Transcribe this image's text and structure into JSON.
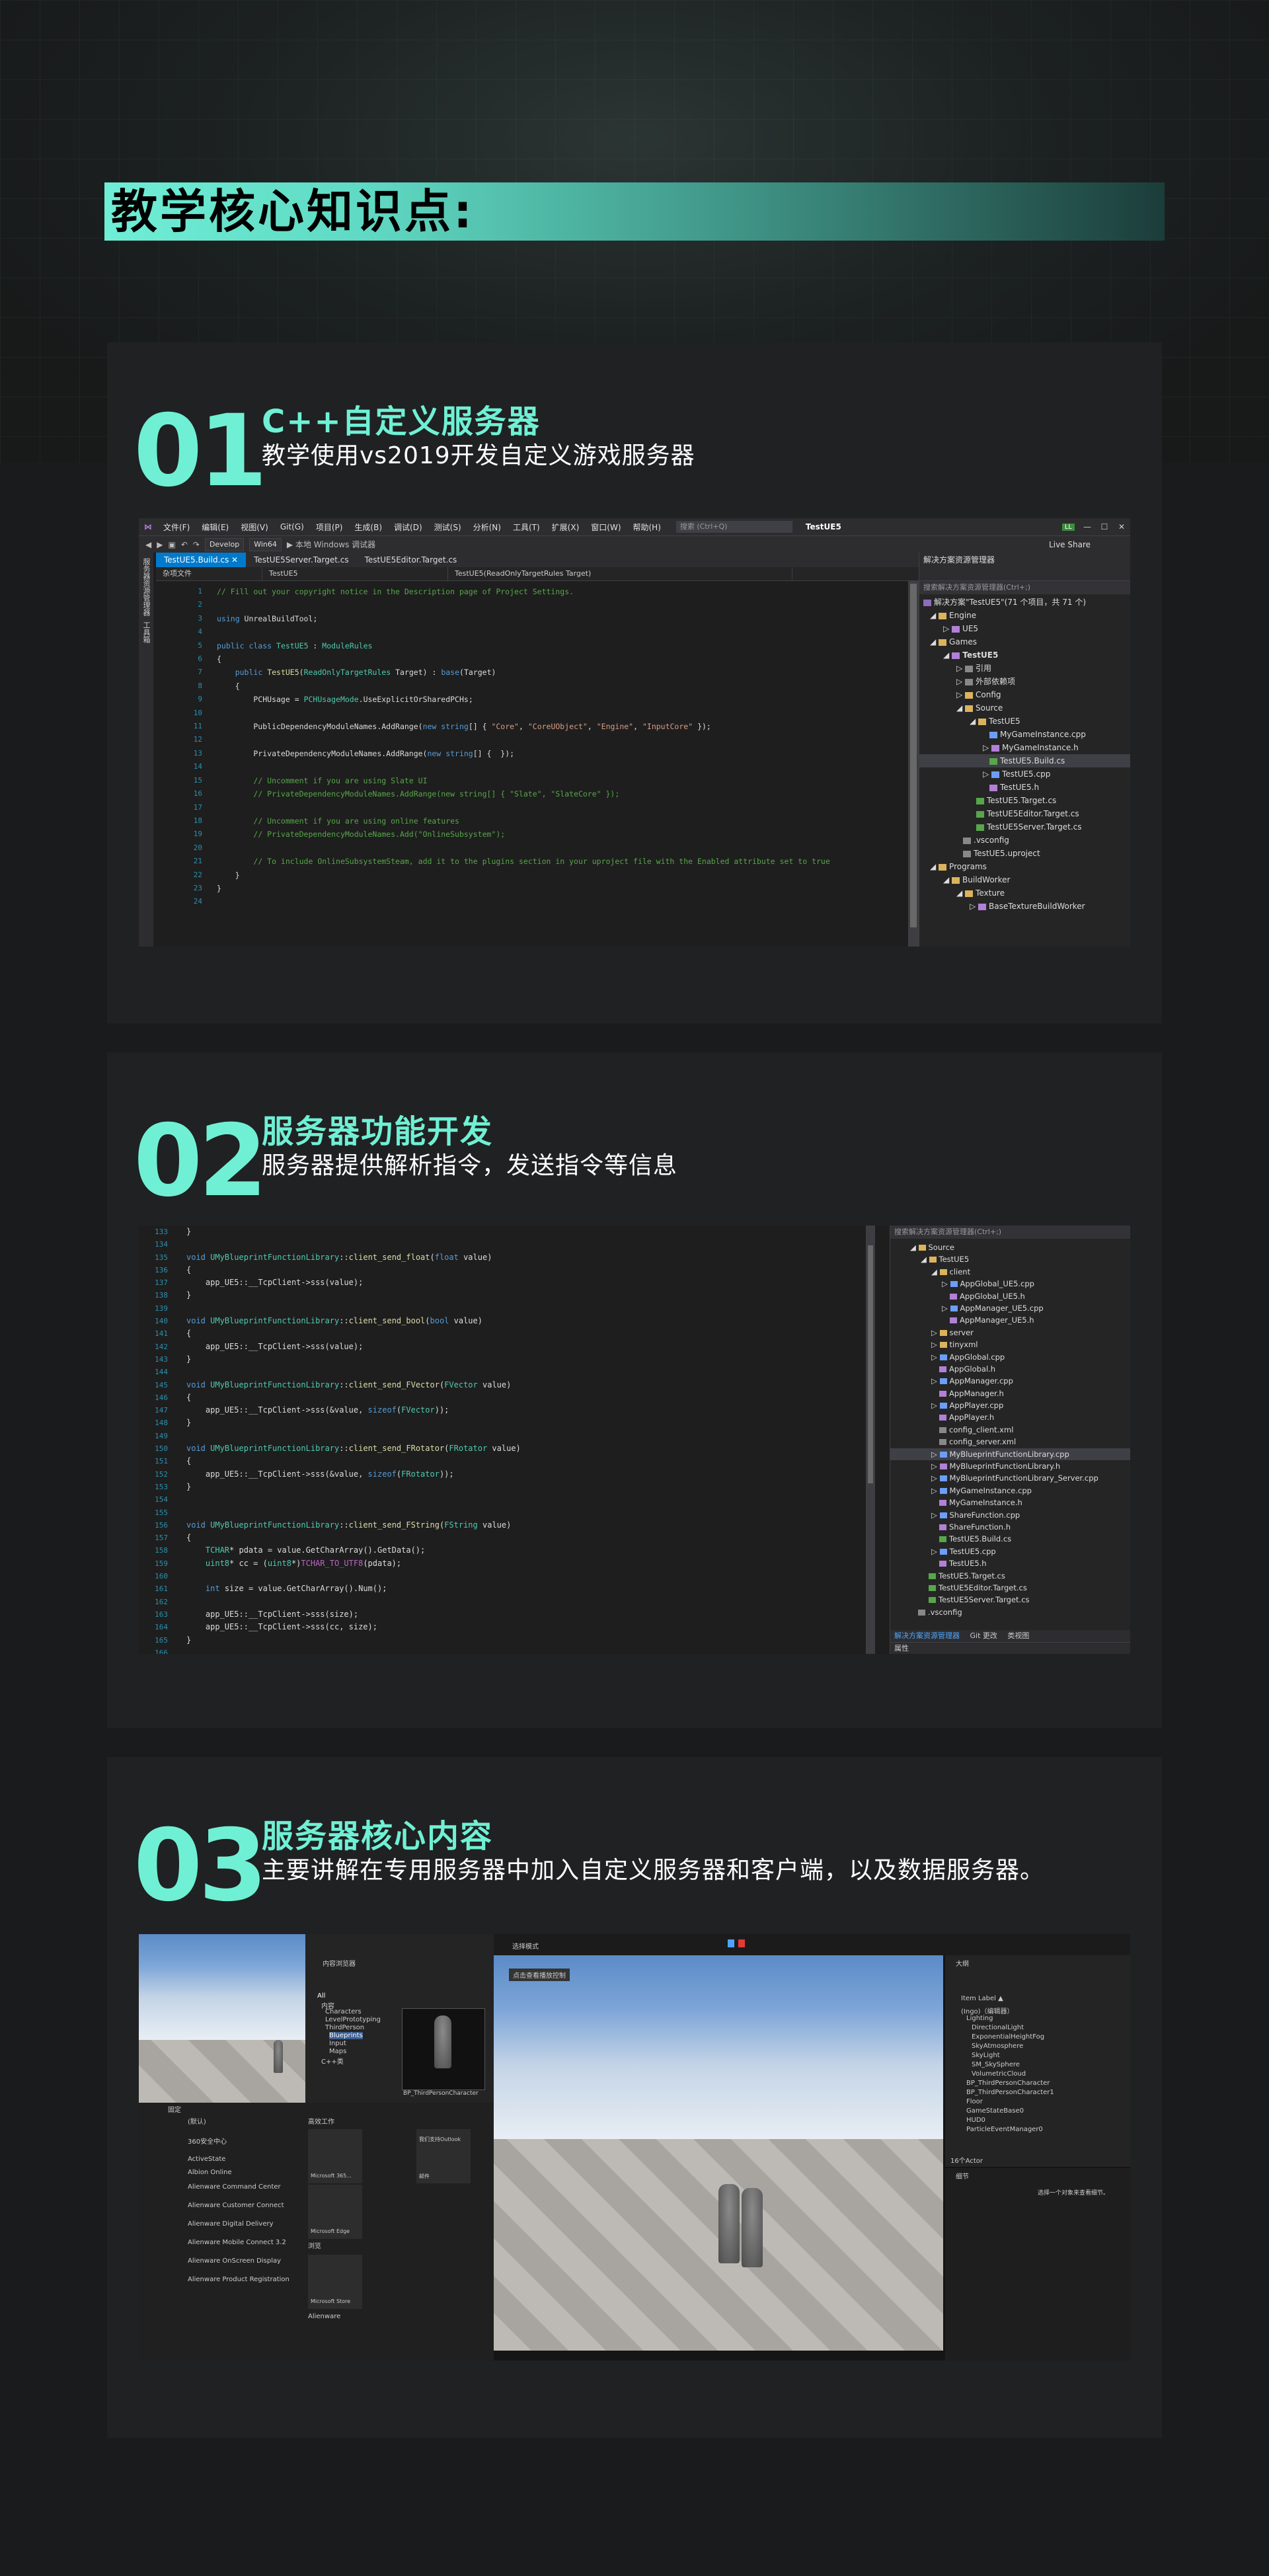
{
  "header": {
    "title": "教学核心知识点:"
  },
  "sections": [
    {
      "number": "01",
      "title": "C++自定义服务器",
      "subtitle": "教学使用vs2019开发自定义游戏服务器"
    },
    {
      "number": "02",
      "title": "服务器功能开发",
      "subtitle": "服务器提供解析指令，发送指令等信息"
    },
    {
      "number": "03",
      "title": "服务器核心内容",
      "subtitle": "主要讲解在专用服务器中加入自定义服务器和客户端，以及数据服务器。"
    }
  ],
  "vs": {
    "menu": [
      "文件(F)",
      "编辑(E)",
      "视图(V)",
      "Git(G)",
      "项目(P)",
      "生成(B)",
      "调试(D)",
      "测试(S)",
      "分析(N)",
      "工具(T)",
      "扩展(X)",
      "窗口(W)",
      "帮助(H)"
    ],
    "search_placeholder": "搜索 (Ctrl+Q)",
    "project": "TestUE5",
    "badge": "LL",
    "config": "Develop",
    "platform": "Win64",
    "debugger": "▶ 本地 Windows 调试器",
    "live_share": "Live Share",
    "left_strip": [
      "服务器资源管理器",
      "工具箱"
    ],
    "tabs": [
      "TestUE5.Build.cs",
      "TestUE5Server.Target.cs",
      "TestUE5Editor.Target.cs"
    ],
    "nav": [
      "杂项文件",
      "TestUE5",
      "TestUE5(ReadOnlyTargetRules Target)"
    ],
    "line_numbers": [
      "1",
      "2",
      "3",
      "4",
      "5",
      "6",
      "7",
      "8",
      "9",
      "10",
      "11",
      "12",
      "13",
      "14",
      "15",
      "16",
      "17",
      "18",
      "19",
      "20",
      "21",
      "22",
      "23",
      "24"
    ],
    "solution_explorer": {
      "title": "解决方案资源管理器",
      "search": "搜索解决方案资源管理器(Ctrl+;)",
      "items": [
        "解决方案\"TestUE5\"(71 个项目，共 71 个)",
        "Engine",
        "UE5",
        "Games",
        "TestUE5",
        "引用",
        "外部依赖项",
        "Config",
        "Source",
        "TestUE5",
        "MyGameInstance.cpp",
        "MyGameInstance.h",
        "TestUE5.Build.cs",
        "TestUE5.cpp",
        "TestUE5.h",
        "TestUE5.Target.cs",
        "TestUE5Editor.Target.cs",
        "TestUE5Server.Target.cs",
        ".vsconfig",
        "TestUE5.uproject",
        "Programs",
        "BuildWorker",
        "Texture",
        "BaseTextureBuildWorker"
      ]
    }
  },
  "ed2": {
    "line_numbers": [
      "133",
      "134",
      "135",
      "136",
      "137",
      "138",
      "139",
      "140",
      "141",
      "142",
      "143",
      "144",
      "145",
      "146",
      "147",
      "148",
      "149",
      "150",
      "151",
      "152",
      "153",
      "154",
      "155",
      "156",
      "157",
      "158",
      "159",
      "160",
      "161",
      "162",
      "163",
      "164",
      "165",
      "166"
    ],
    "search": "搜索解决方案资源管理器(Ctrl+;)",
    "tree": [
      "Source",
      "TestUE5",
      "client",
      "AppGlobal_UE5.cpp",
      "AppGlobal_UE5.h",
      "AppManager_UE5.cpp",
      "AppManager_UE5.h",
      "server",
      "tinyxml",
      "AppGlobal.cpp",
      "AppGlobal.h",
      "AppManager.cpp",
      "AppManager.h",
      "AppPlayer.cpp",
      "AppPlayer.h",
      "config_client.xml",
      "config_server.xml",
      "MyBlueprintFunctionLibrary.cpp",
      "MyBlueprintFunctionLibrary.h",
      "MyBlueprintFunctionLibrary_Server.cpp",
      "MyGameInstance.cpp",
      "MyGameInstance.h",
      "ShareFunction.cpp",
      "ShareFunction.h",
      "TestUE5.Build.cs",
      "TestUE5.cpp",
      "TestUE5.h",
      "TestUE5.Target.cs",
      "TestUE5Editor.Target.cs",
      "TestUE5Server.Target.cs",
      ".vsconfig"
    ],
    "bottom_tabs": [
      "解决方案资源管理器",
      "Git 更改",
      "类视图"
    ],
    "attr": "属性"
  },
  "ue": {
    "content_browser": "内容浏览器",
    "folders": [
      "All",
      "内容",
      "Characters",
      "LevelPrototyping",
      "ThirdPerson",
      "Blueprints",
      "Input",
      "Maps",
      "C++类"
    ],
    "asset": "BP_ThirdPersonCharacter",
    "select_mode": "选择模式",
    "viewport_hint": "点击查看播放控制",
    "outliner_title": "大纲",
    "outliner_items": [
      "Item Label ▲",
      "(Ingo)（编辑器）",
      "Lighting",
      "DirectionalLight",
      "ExponentialHeightFog",
      "SkyAtmosphere",
      "SkyLight",
      "SM_SkySphere",
      "VolumetricCloud",
      "BP_ThirdPersonCharacter",
      "BP_ThirdPersonCharacter1",
      "Floor",
      "GameStateBase0",
      "HUD0",
      "ParticleEventManager0"
    ],
    "actor_count": "16个Actor",
    "details_title": "细节",
    "details_hint": "选择一个对象来查看细节。",
    "start_menu": {
      "pinned": "固定",
      "items": [
        "(默认)",
        "360安全中心",
        "ActiveState",
        "Albion Online",
        "Alienware Command Center",
        "Alienware Customer Connect",
        "Alienware Digital Delivery",
        "Alienware Mobile Connect 3.2",
        "Alienware OnScreen Display",
        "Alienware Product Registration"
      ],
      "tiles_title": "高效工作",
      "tiles": [
        "Microsoft 365...",
        "我们支持Outlook",
        "邮件",
        "Microsoft Edge",
        "Microsoft Store"
      ],
      "section_labels": [
        "浏览",
        "Alienware"
      ]
    }
  }
}
